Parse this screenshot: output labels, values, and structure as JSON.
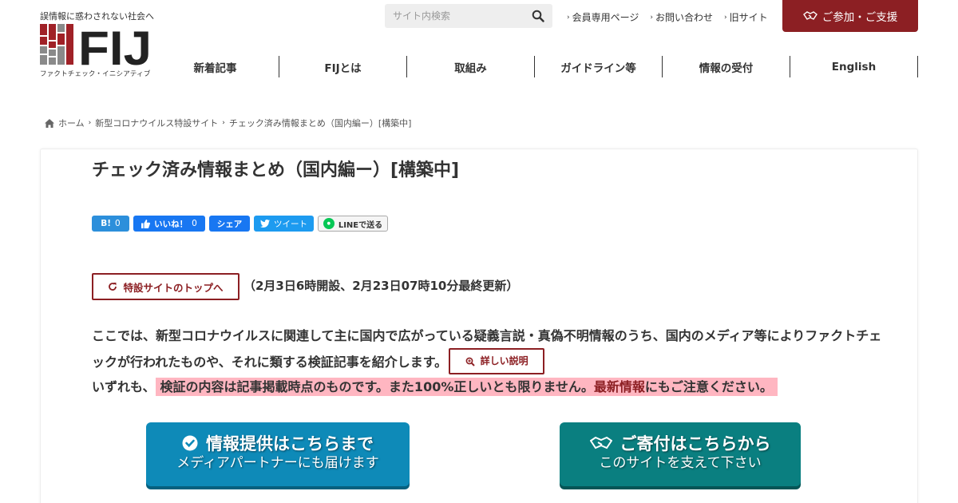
{
  "header": {
    "tagline": "誤情報に惑わされない社会へ",
    "logo_text": "FIJ",
    "logo_subtitle": "ファクトチェック・イニシアティブ",
    "search_placeholder": "サイト内検索",
    "top_links": [
      {
        "label": "会員専用ページ"
      },
      {
        "label": "お問い合わせ"
      },
      {
        "label": "旧サイト"
      }
    ],
    "support_button": "ご参加・ご支援",
    "brand_color": "#8c1f23"
  },
  "nav": {
    "items": [
      {
        "label": "新着記事"
      },
      {
        "label": "FIJとは"
      },
      {
        "label": "取組み"
      },
      {
        "label": "ガイドライン等"
      },
      {
        "label": "情報の受付"
      },
      {
        "label": "English"
      }
    ]
  },
  "breadcrumb": {
    "home": "ホーム",
    "items": [
      "新型コロナウイルス特設サイト",
      "チェック済み情報まとめ（国内編ー）[構築中]"
    ]
  },
  "article": {
    "title": "チェック済み情報まとめ（国内編ー）[構築中]",
    "share": {
      "hatena_label": "B!",
      "hatena_count": "0",
      "like_label": "いいね！",
      "like_count": "0",
      "share_label": "シェア",
      "tweet_label": "ツイート",
      "line_label": "LINEで送る"
    },
    "top_button": "特設サイトのトップへ",
    "updated_text": "（2月3日6時開設、2月23日07時10分最終更新）",
    "intro_text": "ここでは、新型コロナウイルスに関連して主に国内で広がっている疑義言説・真偽不明情報のうち、国内のメディア等によりファクトチェックが行われたものや、それに類する検証記事を紹介します。",
    "detail_button": "詳しい説明",
    "note_prefix": "いずれも、",
    "note_highlight": "検証の内容は記事掲載時点のものです。また100%正しいとも限りません。",
    "note_red": "最新情報",
    "note_suffix": "にもご注意ください。"
  },
  "cta": {
    "info": {
      "line1": "情報提供はこちらまで",
      "line2": "メディアパートナーにも届けます",
      "color": "#0e8ab8"
    },
    "donate": {
      "line1": "ご寄付はこちらから",
      "line2": "このサイトを支えて下さい",
      "color": "#0a7f80"
    }
  }
}
